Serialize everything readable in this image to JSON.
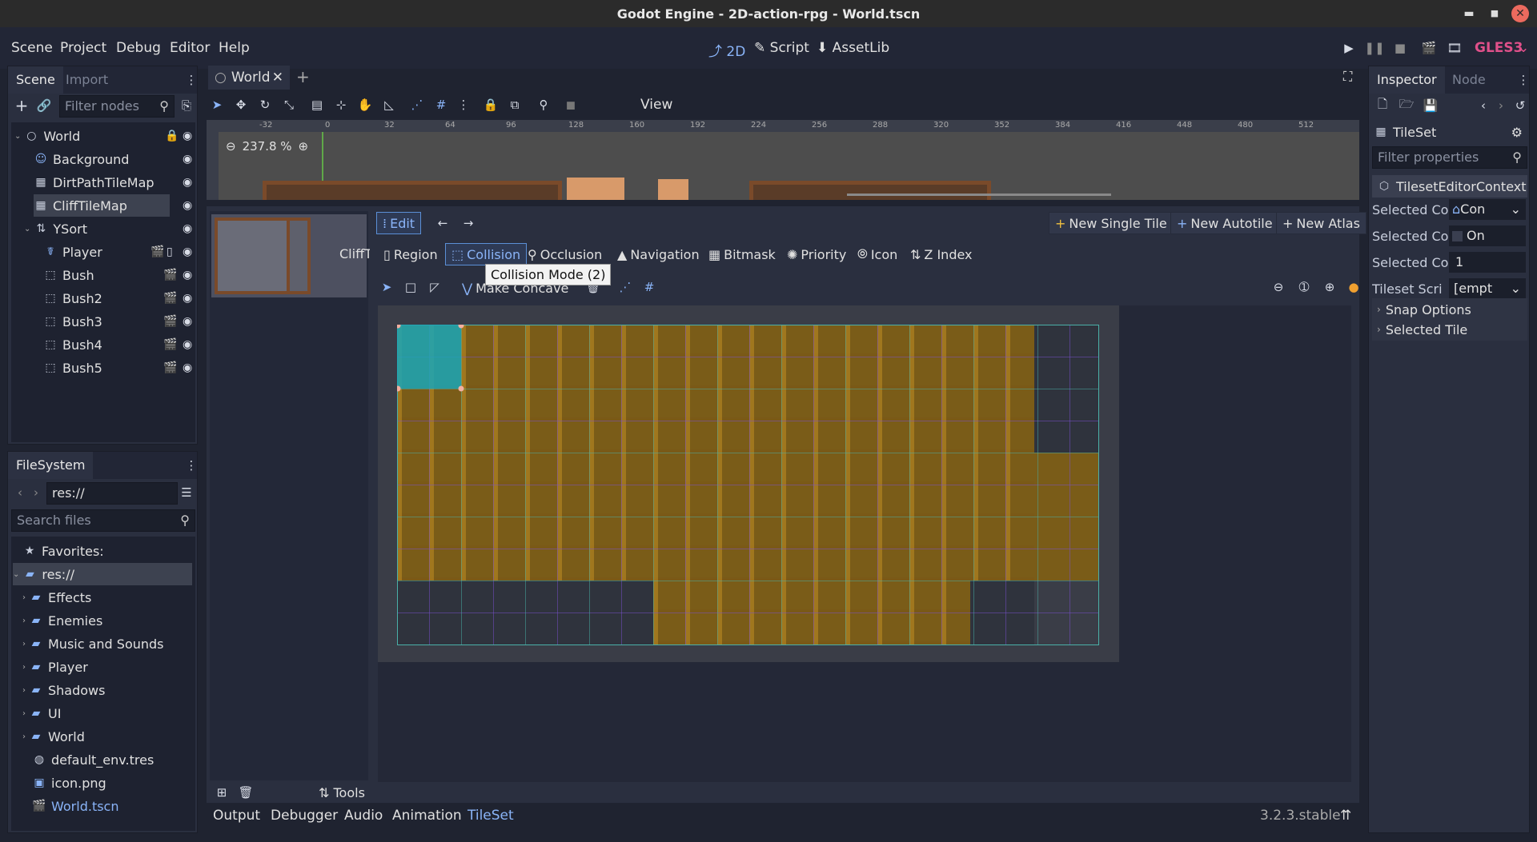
{
  "window": {
    "title": "Godot Engine - 2D-action-rpg - World.tscn",
    "minimize": "▬",
    "maximize": "■",
    "close": "✕"
  },
  "menubar": {
    "items": [
      "Scene",
      "Project",
      "Debug",
      "Editor",
      "Help"
    ],
    "modes": [
      {
        "icon": "2d-icon",
        "label": "2D"
      },
      {
        "icon": "script-icon",
        "label": "Script"
      },
      {
        "icon": "assetlib-icon",
        "label": "AssetLib"
      }
    ],
    "renderer": "GLES3"
  },
  "scene_dock": {
    "tabs": [
      "Scene",
      "Import"
    ],
    "filter_placeholder": "Filter nodes",
    "nodes": [
      {
        "label": "World",
        "depth": 0
      },
      {
        "label": "Background",
        "depth": 1
      },
      {
        "label": "DirtPathTileMap",
        "depth": 1
      },
      {
        "label": "CliffTileMap",
        "depth": 1
      },
      {
        "label": "YSort",
        "depth": 1
      },
      {
        "label": "Player",
        "depth": 2
      },
      {
        "label": "Bush",
        "depth": 2
      },
      {
        "label": "Bush2",
        "depth": 2
      },
      {
        "label": "Bush3",
        "depth": 2
      },
      {
        "label": "Bush4",
        "depth": 2
      },
      {
        "label": "Bush5",
        "depth": 2
      }
    ]
  },
  "filesystem": {
    "tab": "FileSystem",
    "path": "res://",
    "search_placeholder": "Search files",
    "favorites": "Favorites:",
    "root": "res://",
    "folders": [
      "Effects",
      "Enemies",
      "Music and Sounds",
      "Player",
      "Shadows",
      "UI",
      "World"
    ],
    "files": [
      "default_env.tres",
      "icon.png",
      "World.tscn"
    ]
  },
  "editor_tabs": {
    "scene_tab": "World",
    "add": "+"
  },
  "toolbar2d": {
    "view_label": "View",
    "zoom": "237.8 %"
  },
  "ruler": {
    "labels": [
      "-32",
      "0",
      "32",
      "64",
      "96",
      "128",
      "160",
      "192",
      "224",
      "256",
      "288",
      "320",
      "352",
      "384",
      "416",
      "448",
      "480",
      "512"
    ]
  },
  "tileset_editor": {
    "tile_name": "CliffTi",
    "edit_label": "Edit",
    "new_single_tile": "New Single Tile",
    "new_autotile": "New Autotile",
    "new_atlas": "New Atlas",
    "modes": [
      "Region",
      "Collision",
      "Occlusion",
      "Navigation",
      "Bitmask",
      "Priority",
      "Icon",
      "Z Index"
    ],
    "tooltip": "Collision Mode (2)",
    "make_concave": "Make Concave",
    "tools_label": "Tools"
  },
  "bottom_panel": {
    "tabs": [
      "Output",
      "Debugger",
      "Audio",
      "Animation",
      "TileSet"
    ],
    "version": "3.2.3.stable"
  },
  "inspector": {
    "tabs": [
      "Inspector",
      "Node"
    ],
    "resource": "TileSet",
    "filter_placeholder": "Filter properties",
    "context": "TilesetEditorContext",
    "rows": [
      {
        "label": "Selected Co",
        "value": "Con"
      },
      {
        "label": "Selected Co",
        "value": "On"
      },
      {
        "label": "Selected Co",
        "value": "1"
      },
      {
        "label": "Tileset Scri",
        "value": "[empt"
      }
    ],
    "sections": [
      "Snap Options",
      "Selected Tile"
    ]
  },
  "colors": {
    "accent": "#8ab4f8",
    "tile_fill": "#8c7020",
    "selection": "#1aa6b7",
    "grid_purple": "#7a4fd0",
    "grid_teal": "#4ab0a8"
  }
}
